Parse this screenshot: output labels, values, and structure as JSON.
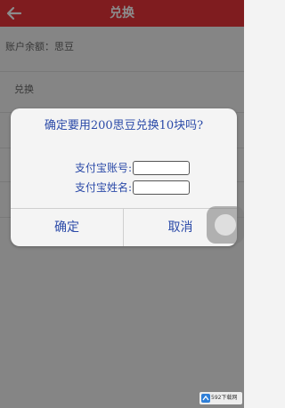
{
  "app_bar": {
    "title": "兑换",
    "back_icon": "back-arrow-icon",
    "color": "#e8333a"
  },
  "background": {
    "account_label": "账户余额：思豆",
    "section_label": "兑换"
  },
  "dialog": {
    "message": "确定要用200思豆兑换10块吗?",
    "fields": [
      {
        "label": "支付宝账号:",
        "value": "",
        "placeholder": ""
      },
      {
        "label": "支付宝姓名:",
        "value": "",
        "placeholder": ""
      }
    ],
    "confirm_label": "确定",
    "cancel_label": "取消",
    "text_color": "#2b4aa8"
  },
  "watermark": {
    "text": "592下载网"
  }
}
